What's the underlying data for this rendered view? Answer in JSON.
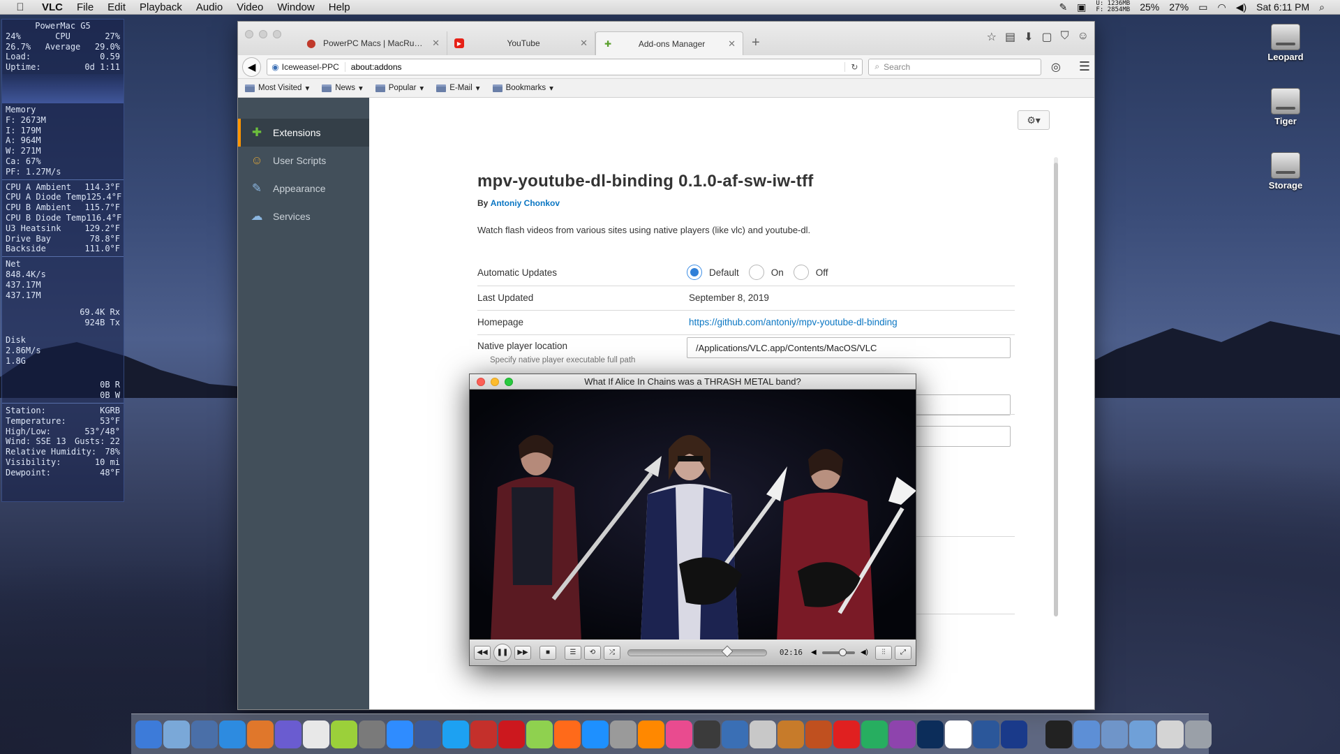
{
  "menubar": {
    "app": "VLC",
    "items": [
      "File",
      "Edit",
      "Playback",
      "Audio",
      "Video",
      "Window",
      "Help"
    ],
    "mem_u": "U: 1236MB",
    "mem_f": "F: 2854MB",
    "cpu1": "25%",
    "cpu2": "27%",
    "clock": "Sat 6:11 PM"
  },
  "monitor": {
    "host": "PowerMac G5",
    "cpu_hdr": [
      "24%",
      "CPU",
      "27%"
    ],
    "cpu_avg": [
      "26.7%",
      "Average",
      "29.0%"
    ],
    "load": [
      "Load:",
      "0.59"
    ],
    "uptime": [
      "Uptime:",
      "0d 1:11"
    ],
    "memory_title": "Memory",
    "memory": [
      "F: 2673M",
      "I: 179M",
      "A: 964M",
      "W: 271M",
      "Ca: 67%",
      "PF: 1.27M/s"
    ],
    "temps": [
      [
        "CPU A Ambient",
        "114.3°F"
      ],
      [
        "CPU A Diode Temp",
        "125.4°F"
      ],
      [
        "CPU B Ambient",
        "115.7°F"
      ],
      [
        "CPU B Diode Temp",
        "116.4°F"
      ],
      [
        "U3 Heatsink",
        "129.2°F"
      ],
      [
        "Drive Bay",
        "78.8°F"
      ],
      [
        "Backside",
        "111.0°F"
      ]
    ],
    "net_title": "Net",
    "net": [
      "848.4K/s",
      "437.17M",
      "437.17M"
    ],
    "net_rx": "69.4K Rx",
    "net_tx": "924B Tx",
    "disk_title": "Disk",
    "disk": [
      "2.86M/s",
      "1.8G"
    ],
    "disk_r": "0B R",
    "disk_w": "0B W",
    "weather": [
      [
        "Station:",
        "KGRB"
      ],
      [
        "Temperature:",
        "53°F"
      ],
      [
        "High/Low:",
        "53°/48°"
      ],
      [
        "Wind: SSE 13",
        "Gusts: 22"
      ],
      [
        "Relative Humidity:",
        "78%"
      ],
      [
        "Visibility:",
        "10 mi"
      ],
      [
        "Dewpoint:",
        "48°F"
      ]
    ]
  },
  "desktop": {
    "icons": [
      "Leopard",
      "Tiger",
      "Storage"
    ]
  },
  "browser": {
    "tabs": [
      {
        "title": "PowerPC Macs | MacRumo…",
        "icon": "macrumors-icon"
      },
      {
        "title": "YouTube",
        "icon": "youtube-icon"
      },
      {
        "title": "Add-ons Manager",
        "icon": "puzzle-icon"
      }
    ],
    "identity": "Iceweasel-PPC",
    "url": "about:addons",
    "search_placeholder": "Search",
    "bookmarks": [
      "Most Visited",
      "News",
      "Popular",
      "E-Mail",
      "Bookmarks"
    ]
  },
  "addons": {
    "sidebar": [
      "Extensions",
      "User Scripts",
      "Appearance",
      "Services"
    ],
    "title": "mpv-youtube-dl-binding  0.1.0-af-sw-iw-tff",
    "by": "By",
    "author": "Antoniy Chonkov",
    "description": "Watch flash videos from various sites using native players (like vlc) and youtube-dl.",
    "auto_updates_label": "Automatic Updates",
    "auto_updates_options": [
      "Default",
      "On",
      "Off"
    ],
    "auto_updates_selected": "Default",
    "last_updated_label": "Last Updated",
    "last_updated": "September 8, 2019",
    "homepage_label": "Homepage",
    "homepage": "https://github.com/antoniy/mpv-youtube-dl-binding",
    "native_player_label": "Native player location",
    "native_player_hint": "Specify native player executable full path",
    "native_player_value": "/Applications/VLC.app/Contents/MacOS/VLC"
  },
  "vlc": {
    "title": "What If Alice In Chains was a THRASH METAL band?",
    "time": "02:16",
    "progress": 0.66,
    "volume": 0.5
  },
  "dock": {
    "items": [
      "finder-icon",
      "network-icon",
      "preview-icon",
      "safari-icon",
      "firefox-icon",
      "tenfourfox-icon",
      "apple-icon",
      "lime-icon",
      "utilities-icon",
      "messenger-icon",
      "facebook-icon",
      "twitter-icon",
      "tenfive-youtube-icon",
      "youtube-icon",
      "music-note-icon",
      "soundcloud-icon",
      "quicktime-icon",
      "speaker-icon",
      "vlc-icon",
      "itunes-icon",
      "movie-icon",
      "clapper-icon",
      "archive-icon",
      "guitar-icon",
      "game-icon",
      "red-icon",
      "hexagon-icon",
      "color-wheel-icon",
      "photoshop-icon",
      "document-icon",
      "word-icon",
      "bbedit-icon",
      "terminal-icon",
      "applications-folder-icon",
      "documents-folder-icon",
      "downloads-folder-icon",
      "stacks-icon",
      "trash-icon"
    ]
  },
  "colors": {
    "accent": "#ff9400",
    "link": "#0a76c3",
    "sidebar": "#424f5a"
  }
}
